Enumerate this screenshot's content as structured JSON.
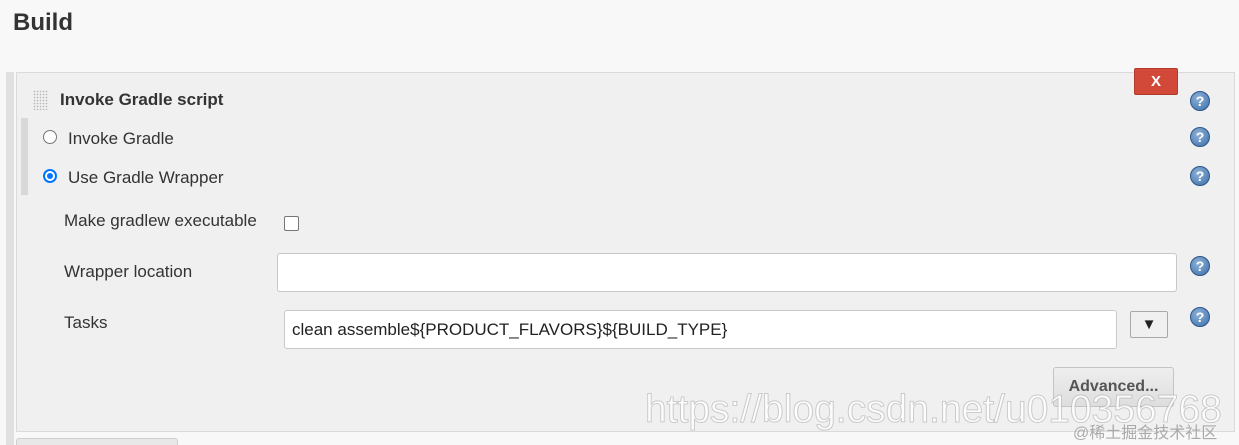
{
  "section": {
    "title": "Build"
  },
  "step": {
    "title": "Invoke Gradle script",
    "delete_label": "X",
    "help_label": "?",
    "options": [
      {
        "label": "Invoke Gradle",
        "selected": false
      },
      {
        "label": "Use Gradle Wrapper",
        "selected": true
      }
    ],
    "make_executable": {
      "label": "Make gradlew executable",
      "checked": false
    },
    "wrapper_location": {
      "label": "Wrapper location",
      "value": ""
    },
    "tasks": {
      "label": "Tasks",
      "value": "clean assemble${PRODUCT_FLAVORS}${BUILD_TYPE}",
      "dropdown_label": "▼"
    },
    "advanced_label": "Advanced..."
  },
  "watermark": {
    "url": "https://blog.csdn.net/u010356768",
    "site": "@稀土掘金技术社区"
  }
}
